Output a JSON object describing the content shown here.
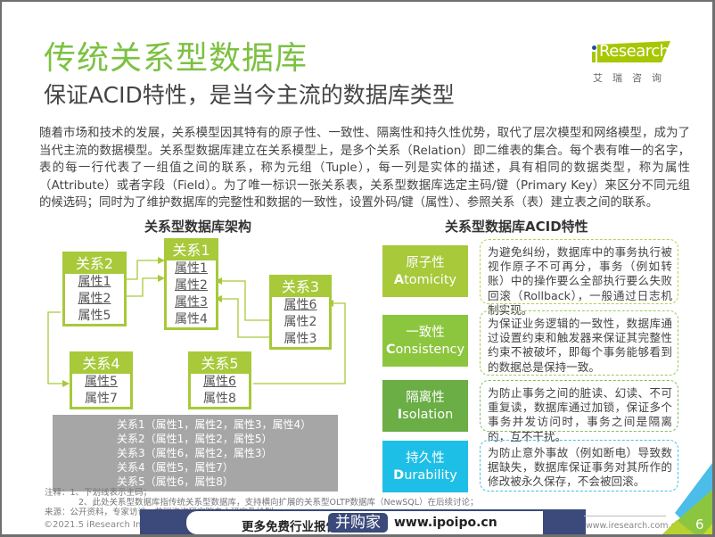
{
  "header": {
    "title": "传统关系型数据库",
    "subtitle": "保证ACID特性，是当今主流的数据库类型",
    "logo": {
      "brand": "Research",
      "brand_prefix": "i",
      "cn": "艾瑞咨询"
    }
  },
  "intro": "随着市场和技术的发展，关系模型因其特有的原子性、一致性、隔离性和持久性优势，取代了层次模型和网络模型，成为了当代主流的数据模型。关系型数据库建立在关系模型上，是多个关系（Relation）即二维表的集合。每个表有唯一的名字，表的每一行代表了一组值之间的联系，称为元组（Tuple），每一列是实体的描述，具有相同的数据类型，称为属性（Attribute）或者字段（Field）。为了唯一标识一张关系表，关系型数据库选定主码/键（Primary Key）来区分不同元组的候选码；同时为了维护数据库的完整性和数据的一致性，设置外码/键（属性）、参照关系（表）建立表之间的联系。",
  "architecture": {
    "title": "关系型数据库架构",
    "relations": [
      {
        "name": "关系1",
        "attributes": [
          {
            "label": "属性1",
            "primary": true
          },
          {
            "label": "属性2",
            "primary": true
          },
          {
            "label": "属性3",
            "primary": true
          },
          {
            "label": "属性4",
            "primary": false
          }
        ]
      },
      {
        "name": "关系2",
        "attributes": [
          {
            "label": "属性1",
            "primary": true
          },
          {
            "label": "属性2",
            "primary": true
          },
          {
            "label": "属性5",
            "primary": false
          }
        ]
      },
      {
        "name": "关系3",
        "attributes": [
          {
            "label": "属性6",
            "primary": true
          },
          {
            "label": "属性2",
            "primary": false
          },
          {
            "label": "属性3",
            "primary": false
          }
        ]
      },
      {
        "name": "关系4",
        "attributes": [
          {
            "label": "属性5",
            "primary": true
          },
          {
            "label": "属性7",
            "primary": false
          }
        ]
      },
      {
        "name": "关系5",
        "attributes": [
          {
            "label": "属性6",
            "primary": true
          },
          {
            "label": "属性8",
            "primary": false
          }
        ]
      }
    ],
    "schema_lines": [
      "关系1（属性1，属性2，属性3，属性4）",
      "关系2（属性1，属性2，属性5）",
      "关系3（属性6，属性2，属性3）",
      "关系4（属性5，属性7）",
      "关系5（属性6，属性8）"
    ]
  },
  "acid": {
    "title": "关系型数据库ACID特性",
    "items": [
      {
        "cn": "原子性",
        "en_initial": "A",
        "en_rest": "tomicity",
        "color": "#a7c93a",
        "border": "#b8d24c",
        "desc": "为避免纠纷，数据库中的事务执行被视作原子不可再分，事务（例如转账）中的操作要么全部执行要么失败回滚（Rollback），一般通过日志机制实现。"
      },
      {
        "cn": "一致性",
        "en_initial": "C",
        "en_rest": "onsistency",
        "color": "#8cc63f",
        "border": "#9ccc55",
        "desc": "为保证业务逻辑的一致性，数据库通过设置约束和触发器来保证其完整性约束不被破坏，即每个事务能够看到的数据总是保持一致。"
      },
      {
        "cn": "隔离性",
        "en_initial": "I",
        "en_rest": "solation",
        "color": "#6aae45",
        "border": "#85bb66",
        "desc": "为防止事务之间的脏读、幻读、不可重复读，数据库通过加锁，保证多个事务并发访问时，事务之间是隔离的，互不干扰。"
      },
      {
        "cn": "持久性",
        "en_initial": "D",
        "en_rest": "urability",
        "color": "#1ebfe6",
        "border": "#3fc4e4",
        "desc": "为防止意外事故（例如断电）导致数据缺失，数据库保证事务对其所作的修改被永久保存，不会被回滚。"
      }
    ]
  },
  "notes": {
    "note1": "注释：1、下划线表示主码；",
    "note2": "2、此处关系型数据库指传统关系型数据库，支持横向扩展的关系型OLTP数据库（NewSQL）在后续讨论；",
    "source": "来源：公开资料，专家访谈，艾瑞咨询研究院自主研究及绘制"
  },
  "footer": {
    "copyright": "©2021.5 iResearch Inc.",
    "banner_text": "更多免费行业报告",
    "banner_brand": "并购家",
    "banner_url": "www.ipoipo.cn",
    "site": "www.iresearch.com.cn",
    "page": "6"
  }
}
